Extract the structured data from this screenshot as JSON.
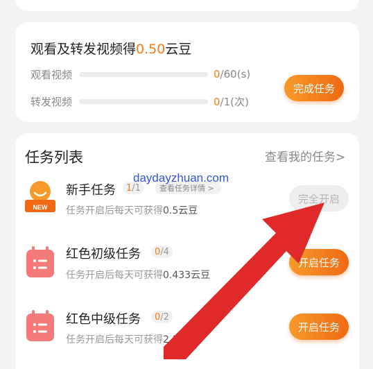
{
  "watch_task": {
    "title": "观看及转发视频得",
    "reward": "0.50",
    "unit": "云豆",
    "rows": [
      {
        "label": "观看视频",
        "current": "0",
        "rest": "/60(s)",
        "progress": 0
      },
      {
        "label": "转发视频",
        "current": "0",
        "rest": "/1(次)",
        "progress": 0
      }
    ],
    "button": "完成任务"
  },
  "task_list": {
    "title": "任务列表",
    "more_link": "查看我的任务>",
    "items": [
      {
        "name": "新手任务",
        "count_current": "1",
        "count_rest": "/1",
        "detail_link": "查看任务详情 >",
        "desc_prefix": "任务开启后每天可获得",
        "desc_value": "0.5云豆",
        "button": "完全开启",
        "button_state": "disabled",
        "icon": "new-user-icon",
        "icon_label": "NEW"
      },
      {
        "name": "红色初级任务",
        "count_current": "0",
        "count_rest": "/4",
        "desc_prefix": "任务开启后每天可获得",
        "desc_value": "0.433云豆",
        "button": "开启任务",
        "button_state": "active",
        "icon": "calendar-icon"
      },
      {
        "name": "红色中级任务",
        "count_current": "0",
        "count_rest": "/2",
        "desc_prefix": "任务开启后每天可获得",
        "desc_value": "2.1",
        "desc_suffix": "云豆",
        "button": "开启任务",
        "button_state": "active",
        "icon": "calendar-icon"
      }
    ]
  },
  "watermark": "daydayzhuan.com",
  "colors": {
    "accent": "#f07c1c",
    "button_gradient_start": "#f79a2a",
    "button_gradient_end": "#f06a14",
    "annotation_arrow": "#e02a2a",
    "watermark": "#3355dd"
  }
}
